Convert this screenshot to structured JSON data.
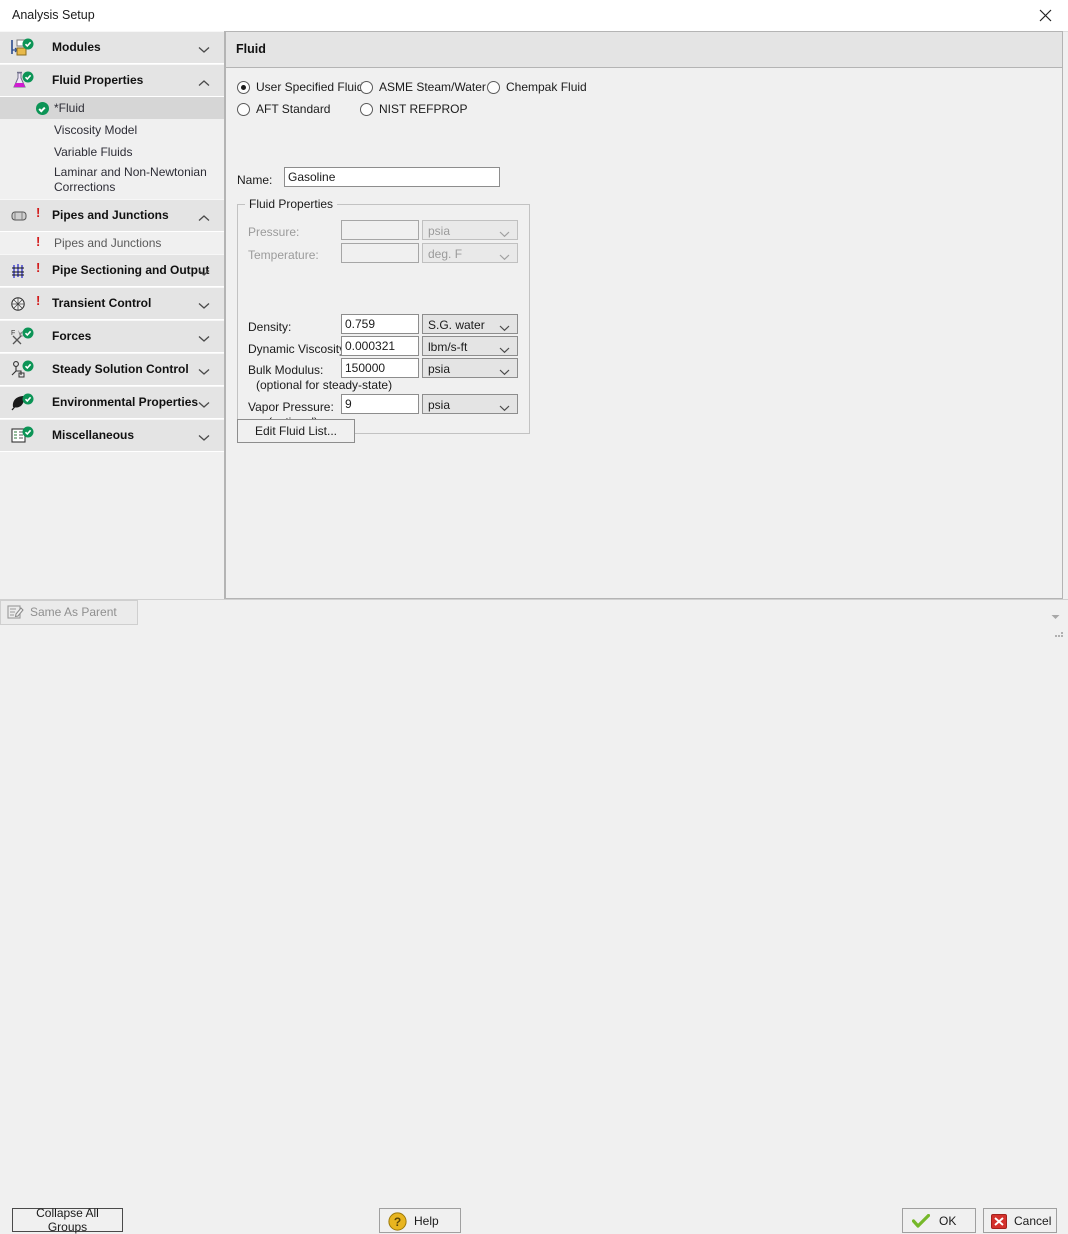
{
  "window": {
    "title": "Analysis Setup",
    "close_icon": "close-icon"
  },
  "sidebar": {
    "groups": [
      {
        "label": "Modules",
        "icon": "modules-icon",
        "status": "check",
        "expanded": false,
        "chevron": "chevron-down-icon",
        "children": []
      },
      {
        "label": "Fluid Properties",
        "icon": "flask-icon",
        "status": "check",
        "expanded": true,
        "chevron": "chevron-up-icon",
        "children": [
          {
            "label": "*Fluid",
            "status": "check",
            "selected": true
          },
          {
            "label": "Viscosity Model",
            "status": "none",
            "selected": false
          },
          {
            "label": "Variable Fluids",
            "status": "none",
            "selected": false
          },
          {
            "label": "Laminar and Non-Newtonian Corrections",
            "status": "none",
            "selected": false
          }
        ]
      },
      {
        "label": "Pipes and Junctions",
        "icon": "pipe-icon",
        "status": "warning",
        "expanded": true,
        "chevron": "chevron-up-icon",
        "children": [
          {
            "label": "Pipes and Junctions",
            "status": "warning",
            "selected": false
          }
        ]
      },
      {
        "label": "Pipe Sectioning and Output",
        "icon": "grid-icon",
        "status": "warning",
        "expanded": false,
        "chevron": "chevron-down-icon",
        "children": []
      },
      {
        "label": "Transient Control",
        "icon": "transient-icon",
        "status": "warning",
        "expanded": false,
        "chevron": "chevron-down-icon",
        "children": []
      },
      {
        "label": "Forces",
        "icon": "forces-icon",
        "status": "check",
        "expanded": false,
        "chevron": "chevron-down-icon",
        "children": []
      },
      {
        "label": "Steady Solution Control",
        "icon": "steady-solution-icon",
        "status": "check",
        "expanded": false,
        "chevron": "chevron-down-icon",
        "children": []
      },
      {
        "label": "Environmental Properties",
        "icon": "leaf-icon",
        "status": "check",
        "expanded": false,
        "chevron": "chevron-down-icon",
        "children": []
      },
      {
        "label": "Miscellaneous",
        "icon": "list-icon",
        "status": "check",
        "expanded": false,
        "chevron": "chevron-down-icon",
        "children": []
      }
    ]
  },
  "panel": {
    "title": "Fluid",
    "fluid_source": {
      "selected": "User Specified Fluid",
      "options": [
        "User Specified Fluid",
        "ASME Steam/Water",
        "Chempak Fluid",
        "AFT Standard",
        "NIST REFPROP"
      ]
    },
    "name_label": "Name:",
    "name_value": "Gasoline",
    "name_placeholder": "",
    "fluid_properties": {
      "legend": "Fluid Properties",
      "rows": [
        {
          "label": "Pressure:",
          "value": "",
          "placeholder": "",
          "unit": "psia",
          "disabled": true,
          "note": ""
        },
        {
          "label": "Temperature:",
          "value": "",
          "placeholder": "",
          "unit": "deg. F",
          "disabled": true,
          "note": ""
        },
        {
          "label": "Density:",
          "value": "0.759",
          "placeholder": "",
          "unit": "S.G. water",
          "disabled": false,
          "note": ""
        },
        {
          "label": "Dynamic Viscosity:",
          "value": "0.000321",
          "placeholder": "",
          "unit": "lbm/s-ft",
          "disabled": false,
          "note": ""
        },
        {
          "label": "Bulk Modulus:",
          "value": "150000",
          "placeholder": "",
          "unit": "psia",
          "disabled": false,
          "note": "(optional for steady-state)"
        },
        {
          "label": "Vapor Pressure:",
          "value": "9",
          "placeholder": "",
          "unit": "psia",
          "disabled": false,
          "note": "(optional)"
        }
      ]
    },
    "edit_fluid_list_label": "Edit Fluid List..."
  },
  "footer": {
    "collapse_label": "Collapse All Groups",
    "same_as_parent_label": "Same As Parent",
    "help_label": "Help",
    "ok_label": "OK",
    "cancel_label": "Cancel"
  },
  "colors": {
    "status_ok": "#0c9456",
    "status_warning": "#d21b1b",
    "window_bg": "#f0f0f0",
    "group_header_bg": "#e4e4e4",
    "selected_row_bg": "#d6d6d6",
    "ok_check": "#76b82a",
    "cancel_red": "#d4312c",
    "help_yellow": "#e8b520"
  }
}
